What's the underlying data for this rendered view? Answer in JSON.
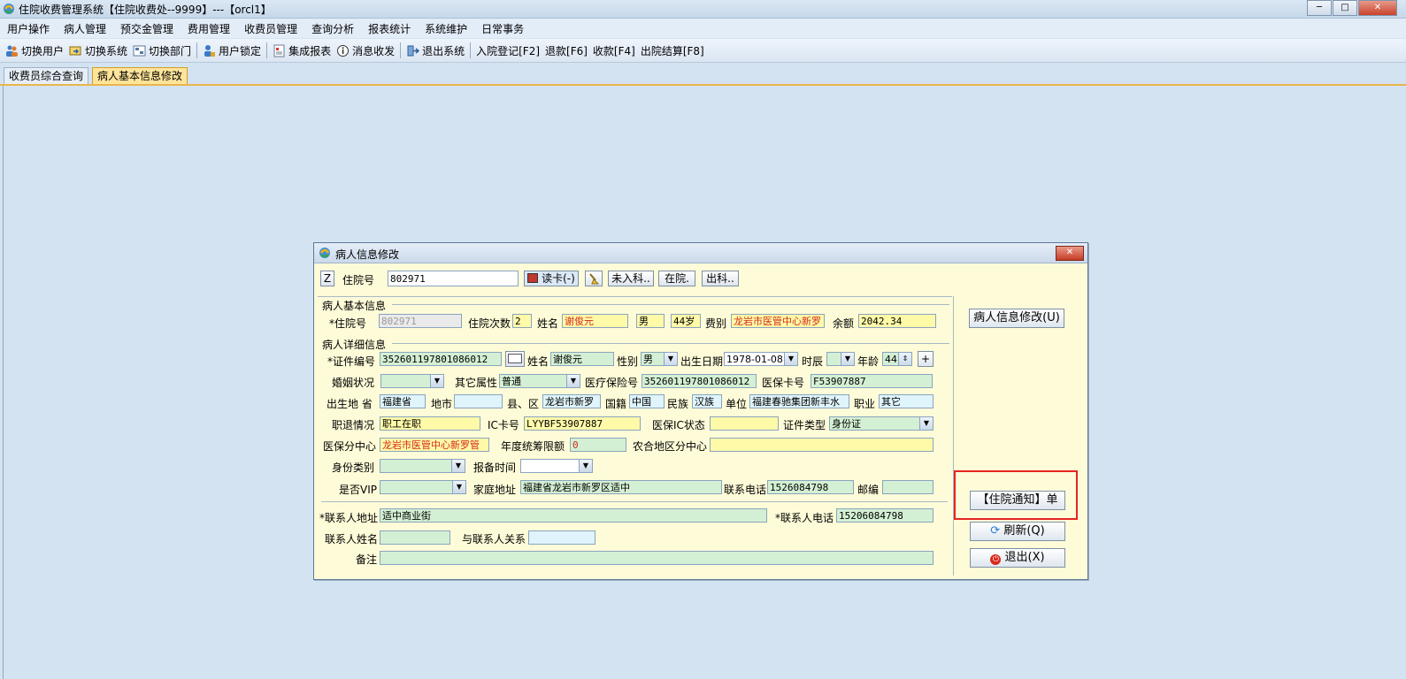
{
  "window": {
    "title": "住院收费管理系统【住院收费处--9999】---【orcl1】",
    "min": "─",
    "max": "□",
    "close": "✕"
  },
  "menu": [
    "用户操作",
    "病人管理",
    "预交金管理",
    "费用管理",
    "收费员管理",
    "查询分析",
    "报表统计",
    "系统维护",
    "日常事务"
  ],
  "toolbar": {
    "switch_user": "切换用户",
    "switch_system": "切换系统",
    "switch_dept": "切换部门",
    "user_lock": "用户锁定",
    "integrated_report": "集成报表",
    "message": "消息收发",
    "exit_system": "退出系统",
    "admission": "入院登记[F2]",
    "refund": "退款[F6]",
    "collect": "收款[F4]",
    "discharge": "出院结算[F8]"
  },
  "tabs": [
    "收费员综合查询",
    "病人基本信息修改"
  ],
  "dialog": {
    "title": "病人信息修改",
    "top": {
      "z": "Z",
      "inpatient_no_label": "住院号",
      "inpatient_no": "802971",
      "read_card": "读卡(-)",
      "not_admitted": "未入科..",
      "in_hospital": "在院.",
      "out_dept": "出科.."
    },
    "basic_section": "病人基本信息",
    "basic": {
      "no_label": "*住院号",
      "no": "802971",
      "times_label": "住院次数",
      "times": "2",
      "name_label": "姓名",
      "name": "谢俊元",
      "sex": "男",
      "age": "44岁",
      "fee_type_label": "费别",
      "fee_type": "龙岩市医管中心新罗",
      "balance_label": "余额",
      "balance": "2042.34"
    },
    "detail_section": "病人详细信息",
    "detail": {
      "id_label": "*证件编号",
      "id_no": "352601197801086012",
      "name_label": "姓名",
      "name": "谢俊元",
      "sex_label": "性别",
      "sex": "男",
      "birth_label": "出生日期",
      "birth": "1978-01-08",
      "hour_label": "时辰",
      "hour": "",
      "age_label": "年龄",
      "age": "44",
      "plus": "+",
      "marital_label": "婚姻状况",
      "marital": "",
      "other_attr_label": "其它属性",
      "other_attr": "普通",
      "insurance_no_label": "医疗保险号",
      "insurance_no": "352601197801086012",
      "ins_card_label": "医保卡号",
      "ins_card": "F53907887",
      "birthplace_label": "出生地 省",
      "province": "福建省",
      "city_label": "地市",
      "city": "",
      "county_label": "县、区",
      "county": "龙岩市新罗",
      "nationality_label": "国籍",
      "nationality": "中国",
      "ethnic_label": "民族",
      "ethnic": "汉族",
      "unit_label": "单位",
      "unit": "福建春驰集团新丰水",
      "job_label": "职业",
      "job": "其它",
      "retire_label": "职退情况",
      "retire": "职工在职",
      "ic_label": "IC卡号",
      "ic": "LYYBF53907887",
      "ic_status_label": "医保IC状态",
      "ic_status": "",
      "id_type_label": "证件类型",
      "id_type": "身份证",
      "center_label": "医保分中心",
      "center": "龙岩市医管中心新罗管",
      "limit_label": "年度统筹限额",
      "limit": "0",
      "rural_label": "农合地区分中心",
      "rural": "",
      "identity_label": "身份类别",
      "identity": "",
      "report_time_label": "报备时间",
      "report_time": "",
      "vip_label": "是否VIP",
      "vip": "",
      "address_label": "家庭地址",
      "address": "福建省龙岩市新罗区适中",
      "phone_label": "联系电话",
      "phone": "1526084798",
      "zip_label": "邮编",
      "zip": ""
    },
    "contact": {
      "addr_label": "*联系人地址",
      "addr": "适中商业街",
      "phone_label": "*联系人电话",
      "phone": "15206084798",
      "name_label": "联系人姓名",
      "name": "",
      "relation_label": "与联系人关系",
      "relation": "",
      "remark_label": "备注",
      "remark": ""
    },
    "side": {
      "modify": "病人信息修改(U)",
      "notice": "【住院通知】单",
      "refresh": "刷新(Q)",
      "exit": "退出(X)"
    }
  }
}
